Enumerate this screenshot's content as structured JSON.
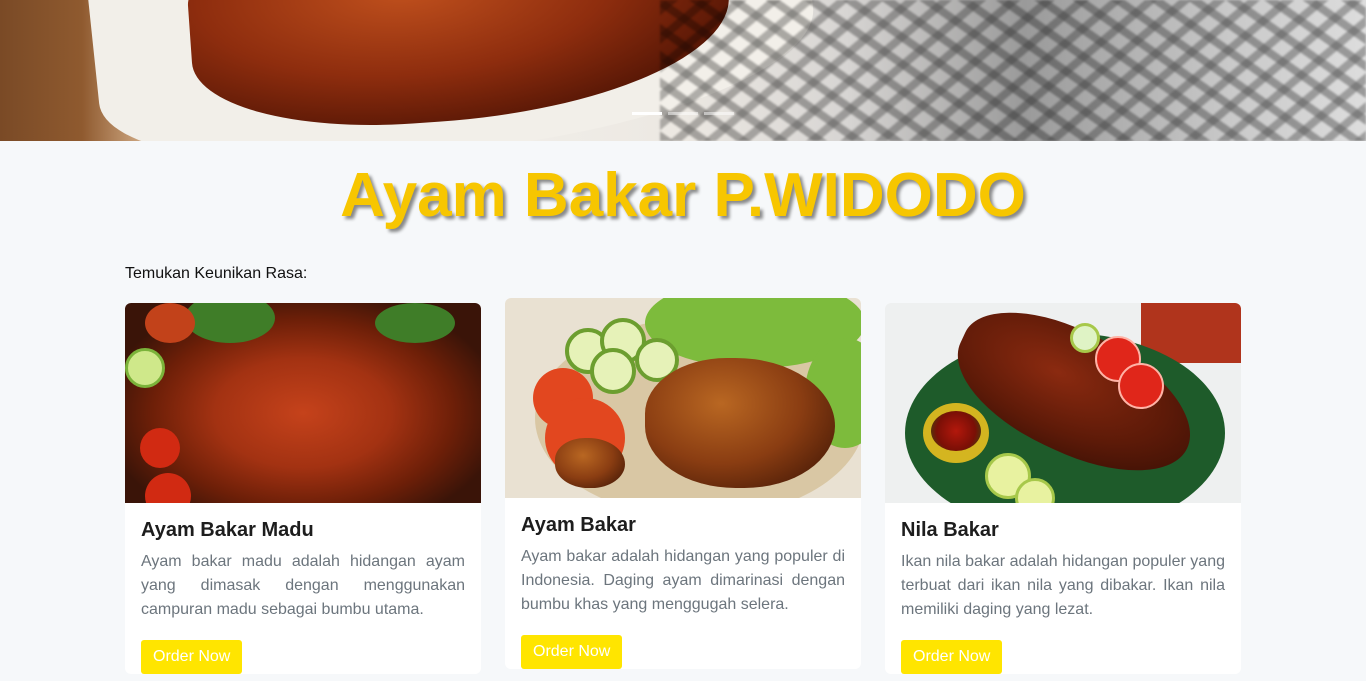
{
  "hero": {
    "slides": [
      "slide-1",
      "slide-2",
      "slide-3"
    ],
    "active_slide": 0
  },
  "brand": {
    "title": "Ayam Bakar P.WIDODO",
    "title_color": "#f7c600"
  },
  "section": {
    "label": "Temukan Keunikan Rasa:"
  },
  "menu": [
    {
      "name": "Ayam Bakar Madu",
      "description": "Ayam bakar madu adalah hidangan ayam yang dimasak dengan menggunakan campuran madu sebagai bumbu utama.",
      "button": "Order Now"
    },
    {
      "name": "Ayam Bakar",
      "description": "Ayam bakar adalah hidangan yang populer di Indonesia. Daging ayam dimarinasi dengan bumbu khas yang menggugah selera.",
      "button": "Order Now"
    },
    {
      "name": "Nila Bakar",
      "description": "Ikan nila bakar adalah hidangan populer yang terbuat dari ikan nila yang dibakar. Ikan nila memiliki daging yang lezat.",
      "button": "Order Now"
    }
  ],
  "colors": {
    "button_bg": "#ffe500",
    "button_text": "#ffffff",
    "page_bg": "#f6f8fa"
  }
}
